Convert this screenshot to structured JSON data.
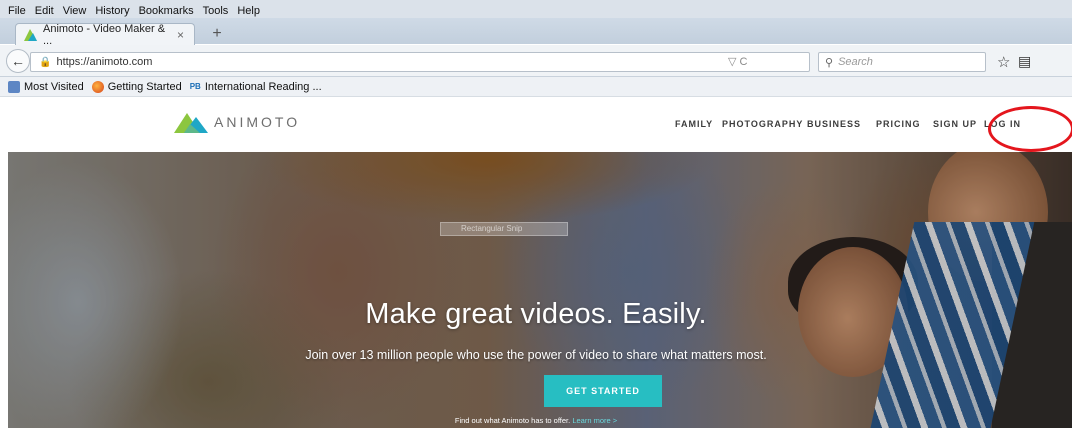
{
  "browser": {
    "menu": [
      "File",
      "Edit",
      "View",
      "History",
      "Bookmarks",
      "Tools",
      "Help"
    ],
    "tab_title": "Animoto - Video Maker & ...",
    "tab_close": "×",
    "new_tab": "+",
    "url": "https://animoto.com",
    "url_icons": "▽ C",
    "search_placeholder": "Search",
    "bookmarks": [
      "Most Visited",
      "Getting Started",
      "International Reading ..."
    ],
    "pb_label": "PB"
  },
  "site": {
    "logo_text": "ANIMOTO",
    "nav": [
      "FAMILY",
      "PHOTOGRAPHY",
      "BUSINESS",
      "PRICING",
      "SIGN UP",
      "LOG IN"
    ],
    "ghost_tool_label": "Rectangular Snip",
    "headline": "Make great videos. Easily.",
    "subline": "Join over 13 million people who use the power of video to share what matters most.",
    "cta_label": "GET STARTED",
    "footnote_text": "Find out what Animoto has to offer.",
    "footnote_link": "Learn more >"
  },
  "colors": {
    "accent": "#27bec2",
    "annotation": "#e4161d",
    "logo_green": "#8cc63f",
    "logo_blue": "#1fa7c6"
  }
}
